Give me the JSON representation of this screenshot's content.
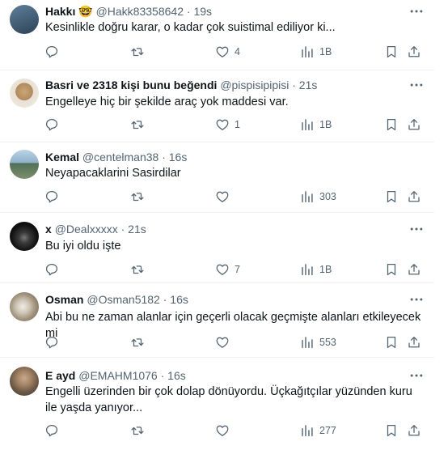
{
  "tweets": [
    {
      "name": "Hakkı 🤓",
      "handle": "@Hakk83358642",
      "sep": "·",
      "time": "19s",
      "text": "Kesinlikle doğru karar, o kadar çok suistimal ediliyor ki...",
      "likes": "4",
      "views": "1B",
      "avatar_color": "#3d5a73"
    },
    {
      "name": "Basri ve 2318 kişi bunu beğendi",
      "handle": "@pispisipipisi",
      "sep": "·",
      "time": "21s",
      "text": "Engelleye hiç bir şekilde araç yok maddesi var.",
      "likes": "1",
      "views": "1B",
      "avatar_color": "#d9c7a8"
    },
    {
      "name": "Kemal",
      "handle": "@centelman38",
      "sep": "·",
      "time": "16s",
      "text": "Neyapacaklarini Sasirdilar",
      "likes": "",
      "views": "303",
      "avatar_color": "#7fa3bd"
    },
    {
      "name": "x",
      "handle": "@Dealxxxxx",
      "sep": "·",
      "time": "21s",
      "text": "Bu iyi oldu işte",
      "likes": "7",
      "views": "1B",
      "avatar_color": "#1a1a1a"
    },
    {
      "name": "Osman",
      "handle": "@Osman5182",
      "sep": "·",
      "time": "16s",
      "text": "Abi bu ne zaman alanlar için geçerli olacak geçmişte alanları etkileyecek mi",
      "likes": "",
      "views": "553",
      "avatar_color": "#b9ab95"
    },
    {
      "name": "E ayd",
      "handle": "@EMAHM1076",
      "sep": "·",
      "time": "16s",
      "text": "Engelli üzerinden bir çok dolap dönüyordu. Üçkağıtçılar yüzünden kuru ile yaşda yanıyor...",
      "likes": "",
      "views": "277",
      "avatar_color": "#8a7560"
    }
  ],
  "icons": {
    "more": "more-icon",
    "reply": "reply-icon",
    "retweet": "retweet-icon",
    "like": "heart-icon",
    "views": "views-icon",
    "bookmark": "bookmark-icon",
    "share": "share-icon"
  },
  "colors": {
    "text": "#0f1419",
    "secondary": "#536471",
    "divider": "#eff3f4"
  }
}
